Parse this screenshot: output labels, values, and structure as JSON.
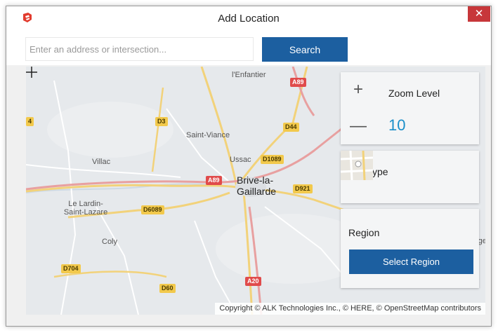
{
  "window": {
    "title": "Add Location",
    "close_label": "✕",
    "app_icon": "sketchup-icon"
  },
  "search": {
    "placeholder": "Enter an address or intersection...",
    "value": "",
    "button_label": "Search"
  },
  "map": {
    "labels": {
      "enfantier": "l'Enfantier",
      "saint_viance": "Saint-Viance",
      "ussac": "Ussac",
      "villac": "Villac",
      "brive": "Brive-la-Gaillarde",
      "le_lardin": "Le Lardin-Saint-Lazare",
      "coly": "Coly",
      "edge_right": "rge"
    },
    "shields": {
      "a89_top": "A89",
      "d3": "D3",
      "d44": "D44",
      "d1089": "D1089",
      "a89_mid": "A89",
      "d921": "D921",
      "d6089": "D6089",
      "d704": "D704",
      "d60": "D60",
      "a20": "A20",
      "edge_left": "4"
    },
    "copyright": "Copyright © ALK Technologies Inc., © HERE, © OpenStreetMap contributors"
  },
  "zoom": {
    "label": "Zoom Level",
    "value": "10",
    "in_symbol": "+",
    "out_symbol": "—"
  },
  "map_type": {
    "label": "Map type"
  },
  "region": {
    "label": "Region",
    "button_label": "Select Region"
  },
  "colors": {
    "accent": "#1c5fa0",
    "zoom_value": "#1a8fc9",
    "close": "#c7373a",
    "highway": "#e04b4b",
    "route": "#f2c94c"
  }
}
